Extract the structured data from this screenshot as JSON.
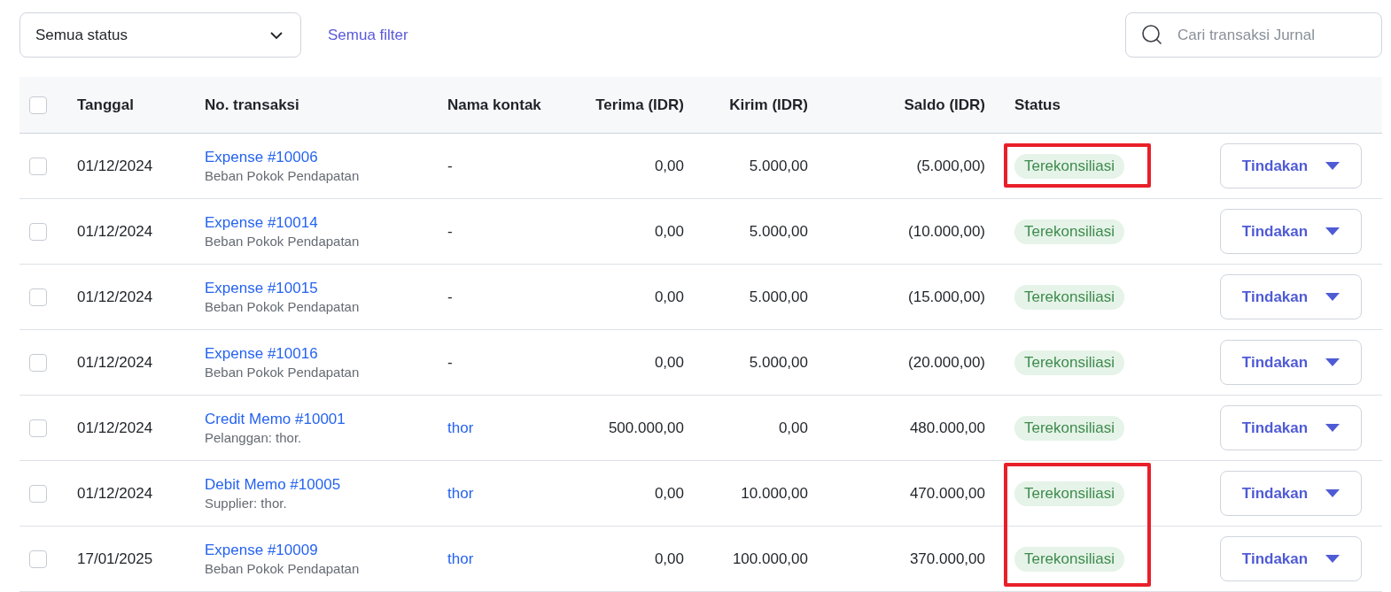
{
  "toolbar": {
    "status_select": {
      "value": "Semua status"
    },
    "filter_link": "Semua filter",
    "search": {
      "placeholder": "Cari transaksi Jurnal"
    }
  },
  "table": {
    "select_all": {
      "checked": false
    },
    "columns": [
      "Tanggal",
      "No. transaksi",
      "Nama kontak",
      "Terima (IDR)",
      "Kirim (IDR)",
      "Saldo (IDR)",
      "Status"
    ],
    "rows": [
      {
        "checked": false,
        "date": "01/12/2024",
        "transaction": "Expense #10006",
        "subtitle": "Beban Pokok Pendapatan",
        "contact": "-",
        "contact_link": false,
        "received": "0,00",
        "sent": "5.000,00",
        "balance": "(5.000,00)",
        "status": "Terekonsiliasi",
        "action": "Tindakan",
        "marked": true
      },
      {
        "checked": false,
        "date": "01/12/2024",
        "transaction": "Expense #10014",
        "subtitle": "Beban Pokok Pendapatan",
        "contact": "-",
        "contact_link": false,
        "received": "0,00",
        "sent": "5.000,00",
        "balance": "(10.000,00)",
        "status": "Terekonsiliasi",
        "action": "Tindakan",
        "marked": false
      },
      {
        "checked": false,
        "date": "01/12/2024",
        "transaction": "Expense #10015",
        "subtitle": "Beban Pokok Pendapatan",
        "contact": "-",
        "contact_link": false,
        "received": "0,00",
        "sent": "5.000,00",
        "balance": "(15.000,00)",
        "status": "Terekonsiliasi",
        "action": "Tindakan",
        "marked": false
      },
      {
        "checked": false,
        "date": "01/12/2024",
        "transaction": "Expense #10016",
        "subtitle": "Beban Pokok Pendapatan",
        "contact": "-",
        "contact_link": false,
        "received": "0,00",
        "sent": "5.000,00",
        "balance": "(20.000,00)",
        "status": "Terekonsiliasi",
        "action": "Tindakan",
        "marked": false
      },
      {
        "checked": false,
        "date": "01/12/2024",
        "transaction": "Credit Memo #10001",
        "subtitle": "Pelanggan: thor.",
        "contact": "thor",
        "contact_link": true,
        "received": "500.000,00",
        "sent": "0,00",
        "balance": "480.000,00",
        "status": "Terekonsiliasi",
        "action": "Tindakan",
        "marked": false
      },
      {
        "checked": false,
        "date": "01/12/2024",
        "transaction": "Debit Memo #10005",
        "subtitle": "Supplier: thor.",
        "contact": "thor",
        "contact_link": true,
        "received": "0,00",
        "sent": "10.000,00",
        "balance": "470.000,00",
        "status": "Terekonsiliasi",
        "action": "Tindakan",
        "marked": true
      },
      {
        "checked": false,
        "date": "17/01/2025",
        "transaction": "Expense #10009",
        "subtitle": "Beban Pokok Pendapatan",
        "contact": "thor",
        "contact_link": true,
        "received": "0,00",
        "sent": "100.000,00",
        "balance": "370.000,00",
        "status": "Terekonsiliasi",
        "action": "Tindakan",
        "marked": true
      }
    ]
  }
}
